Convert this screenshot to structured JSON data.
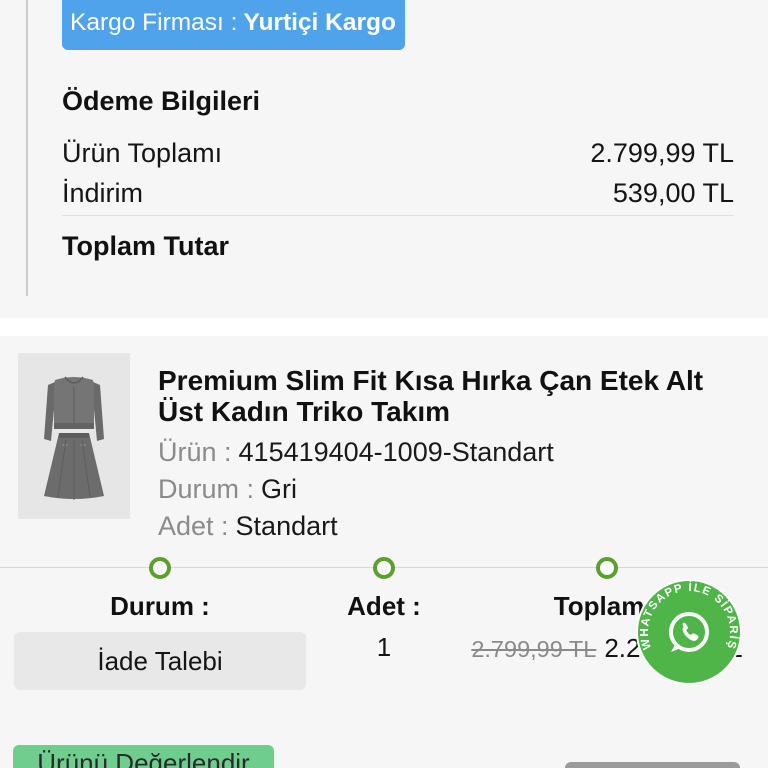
{
  "shipping": {
    "label": "Kargo Firması :",
    "company": "Yurtiçi Kargo"
  },
  "payment": {
    "title": "Ödeme Bilgileri",
    "rows": [
      {
        "label": "Ürün Toplamı",
        "value": "2.799,99 TL"
      },
      {
        "label": "İndirim",
        "value": "539,00 TL"
      }
    ],
    "total_label": "Toplam Tutar"
  },
  "product": {
    "image": "cardigan-and-skirt-set-photo",
    "title": "Premium Slim Fit Kısa Hırka Çan Etek Alt Üst Kadın Triko Takım",
    "details": [
      {
        "label": "Ürün :",
        "value": "415419404-1009-Standart"
      },
      {
        "label": "Durum :",
        "value": "Gri"
      },
      {
        "label": "Adet :",
        "value": "Standart"
      }
    ]
  },
  "order_item": {
    "status": {
      "label": "Durum :",
      "button": "İade Talebi"
    },
    "quantity": {
      "label": "Adet :",
      "value": "1"
    },
    "total": {
      "label": "Toplam :",
      "old_price": "2.799,99 TL",
      "price": "2.260,99 TL"
    }
  },
  "actions": {
    "review_button": "Ürünü Değerlendir"
  },
  "whatsapp": {
    "label": "WHATSAPP İLE SİPARİŞ",
    "icon": "whatsapp-icon"
  },
  "icons": {
    "step_dot": "status-step-dot-icon"
  },
  "colors": {
    "shipping_badge": "#4fa3ea",
    "step_green": "#5b9f2f",
    "whatsapp_green": "#4fb548",
    "review_button": "#6fce8e",
    "muted_text": "#8b8b8b"
  }
}
